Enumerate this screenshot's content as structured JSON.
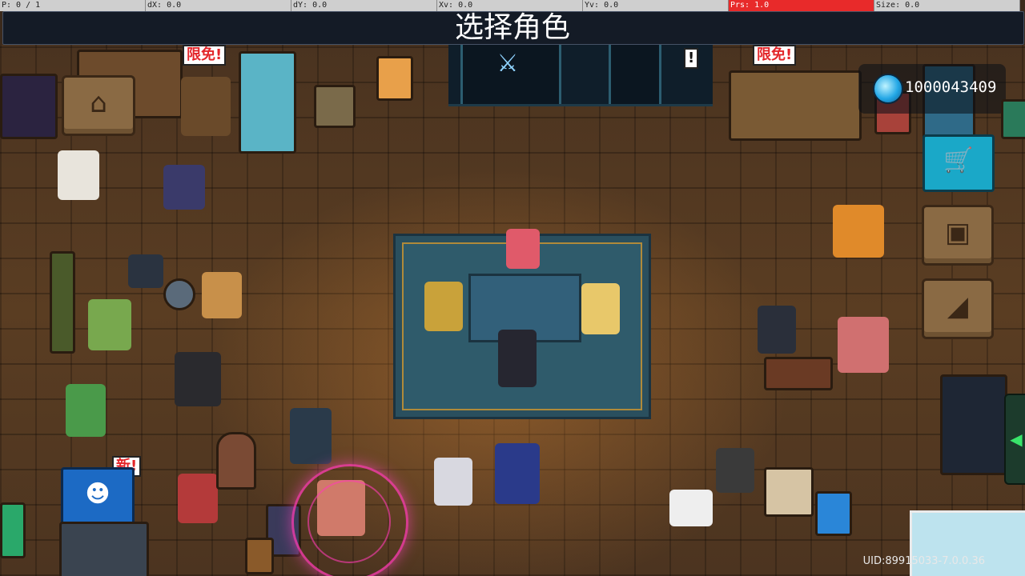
{
  "debug_bar": {
    "cells": [
      "P: 0 / 1",
      "dX: 0.0",
      "dY: 0.0",
      "Xv: 0.0",
      "Yv: 0.0",
      "Prs: 1.0",
      "Size: 0.0"
    ],
    "alert_color": "#e82a2a"
  },
  "header": {
    "title": "选择角色"
  },
  "hud": {
    "gem_count": "1000043409",
    "uid": "UID:89915033-7.0.0.36"
  },
  "badges": {
    "limited_a": "限免!",
    "limited_b": "限免!",
    "new": "新!",
    "alert": "!"
  },
  "icons": {
    "home": "home-icon",
    "profile": "profile-card-icon",
    "stairs": "stairs-icon",
    "shop": "shop-cart-icon",
    "gem": "gem-icon",
    "robot": "robot-face-icon",
    "arrow": "arrow-right-icon",
    "crossed_swords": "crossed-swords-icon"
  },
  "colors": {
    "accent": "#23a7e6",
    "title_bg": "#141b26",
    "floor": "#4a3320"
  }
}
